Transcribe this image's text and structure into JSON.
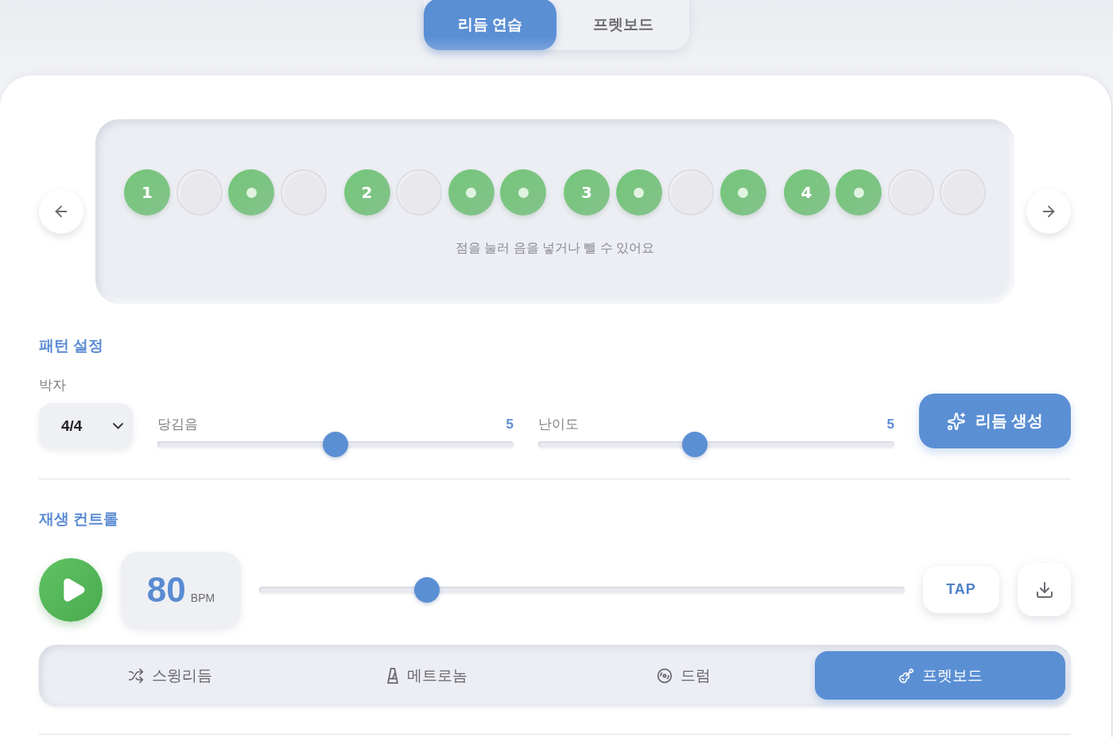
{
  "top_tabs": [
    {
      "label": "리듬 연습",
      "selected": true
    },
    {
      "label": "프렛보드",
      "selected": false
    }
  ],
  "pattern": {
    "beats": [
      {
        "steps": [
          {
            "label": "1",
            "on": true
          },
          {
            "on": false
          },
          {
            "on": true
          },
          {
            "on": false
          }
        ]
      },
      {
        "steps": [
          {
            "label": "2",
            "on": true
          },
          {
            "on": false
          },
          {
            "on": true
          },
          {
            "on": true
          }
        ]
      },
      {
        "steps": [
          {
            "label": "3",
            "on": true
          },
          {
            "on": true
          },
          {
            "on": false
          },
          {
            "on": true
          }
        ]
      },
      {
        "steps": [
          {
            "label": "4",
            "on": true
          },
          {
            "on": true
          },
          {
            "on": false
          },
          {
            "on": false
          }
        ]
      }
    ],
    "hint": "점을 눌러 음을 넣거나 뺄 수 있어요"
  },
  "pattern_settings": {
    "title": "패턴 설정",
    "meter": {
      "label": "박자",
      "value": "4/4"
    },
    "sliders": [
      {
        "label": "당김음",
        "reading": "5",
        "level": 0.5
      },
      {
        "label": "난이도",
        "reading": "5",
        "level": 0.44
      }
    ],
    "generate_button": "리듬 생성"
  },
  "playback": {
    "title": "재생 컨트롤",
    "tempo": {
      "value": "80",
      "unit": "BPM",
      "level": 0.26
    },
    "tap_button": "TAP"
  },
  "modes": [
    {
      "label": "스윙리듬",
      "selected": false
    },
    {
      "label": "메트로놈",
      "selected": false
    },
    {
      "label": "드럼",
      "selected": false
    },
    {
      "label": "프렛보드",
      "selected": true
    }
  ]
}
